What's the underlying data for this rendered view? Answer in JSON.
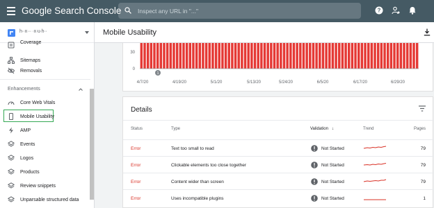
{
  "app": {
    "title": "Google Search Console",
    "search_placeholder": "Inspect any URL in \"...\""
  },
  "sidebar": {
    "property_name": "h··x··· ·x·u·h··",
    "items": [
      {
        "label": "Coverage",
        "icon": "coverage-icon"
      },
      {
        "label": "Sitemaps",
        "icon": "sitemaps-icon"
      },
      {
        "label": "Removals",
        "icon": "removals-icon"
      }
    ],
    "section": "Enhancements",
    "enhancements": [
      {
        "label": "Core Web Vitals",
        "icon": "speed-icon"
      },
      {
        "label": "Mobile Usability",
        "icon": "phone-icon",
        "selected": true
      },
      {
        "label": "AMP",
        "icon": "bolt-icon"
      },
      {
        "label": "Events",
        "icon": "layers-icon"
      },
      {
        "label": "Logos",
        "icon": "layers-icon"
      },
      {
        "label": "Products",
        "icon": "layers-icon"
      },
      {
        "label": "Review snippets",
        "icon": "layers-icon"
      },
      {
        "label": "Unparsable structured data",
        "icon": "layers-icon"
      }
    ],
    "selected_color": "#34a853"
  },
  "page": {
    "title": "Mobile Usability"
  },
  "chart_data": {
    "type": "bar",
    "y_ticks": [
      "30",
      "0"
    ],
    "x_ticks": [
      "4/7/20",
      "4/19/20",
      "5/1/20",
      "5/13/20",
      "5/24/20",
      "6/5/20",
      "6/17/20",
      "6/29/20"
    ],
    "bar_color": "#e53935",
    "annotation": "1",
    "note": "Bars extend above visible area"
  },
  "details": {
    "title": "Details",
    "columns": {
      "status": "Status",
      "type": "Type",
      "validation": "Validation",
      "validation_sort": "↓",
      "trend": "Trend",
      "pages": "Pages"
    },
    "rows": [
      {
        "status": "Error",
        "type": "Text too small to read",
        "validation": "Not Started",
        "pages": "79"
      },
      {
        "status": "Error",
        "type": "Clickable elements too close together",
        "validation": "Not Started",
        "pages": "79"
      },
      {
        "status": "Error",
        "type": "Content wider than screen",
        "validation": "Not Started",
        "pages": "79"
      },
      {
        "status": "Error",
        "type": "Uses incompatible plugins",
        "validation": "Not Started",
        "pages": "1"
      }
    ],
    "error_color": "#d93025"
  }
}
